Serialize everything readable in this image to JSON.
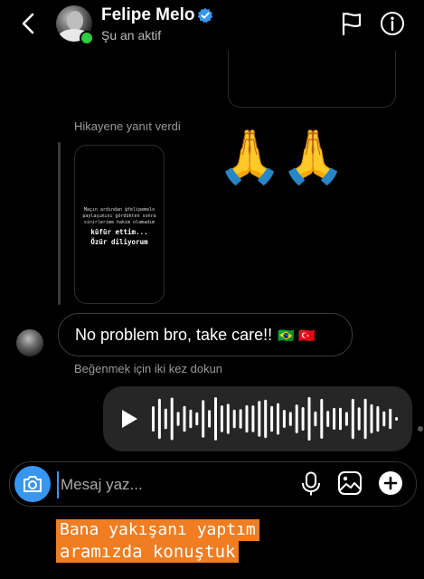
{
  "header": {
    "contact_name": "Felipe Melo",
    "status": "Şu an aktif",
    "icons": {
      "back": "chevron-left-icon",
      "verified": "verified-badge-icon",
      "flag": "flag-icon",
      "info": "info-icon"
    },
    "colors": {
      "online": "#2ecc40",
      "verified": "#3797f0"
    }
  },
  "thread": {
    "story_reply_label": "Hikayene yanıt verdi",
    "story_card": {
      "small_text": "Maçın ardından @felipemelo paylaşımını gördükten sonra sinirlerime hakim olamadım",
      "big_text_line1": "küfür ettim...",
      "big_text_line2": "Özür diliyorum"
    },
    "reaction_emoji": "🙏🙏",
    "message": {
      "text": "No problem bro, take care!!",
      "flags": "🇧🇷 🇹🇷"
    },
    "like_hint": "Beğenmek için iki kez dokun",
    "voice_message": {
      "icon": "play-icon"
    }
  },
  "composer": {
    "placeholder": "Mesaj yaz...",
    "value": "",
    "icons": [
      "camera-icon",
      "microphone-icon",
      "gallery-icon",
      "add-icon"
    ],
    "accent_color": "#3797f0"
  },
  "overlay_caption": {
    "line1": "Bana yakışanı yaptım",
    "line2": "aramızda konuştuk",
    "highlight_color": "#f07d22"
  }
}
